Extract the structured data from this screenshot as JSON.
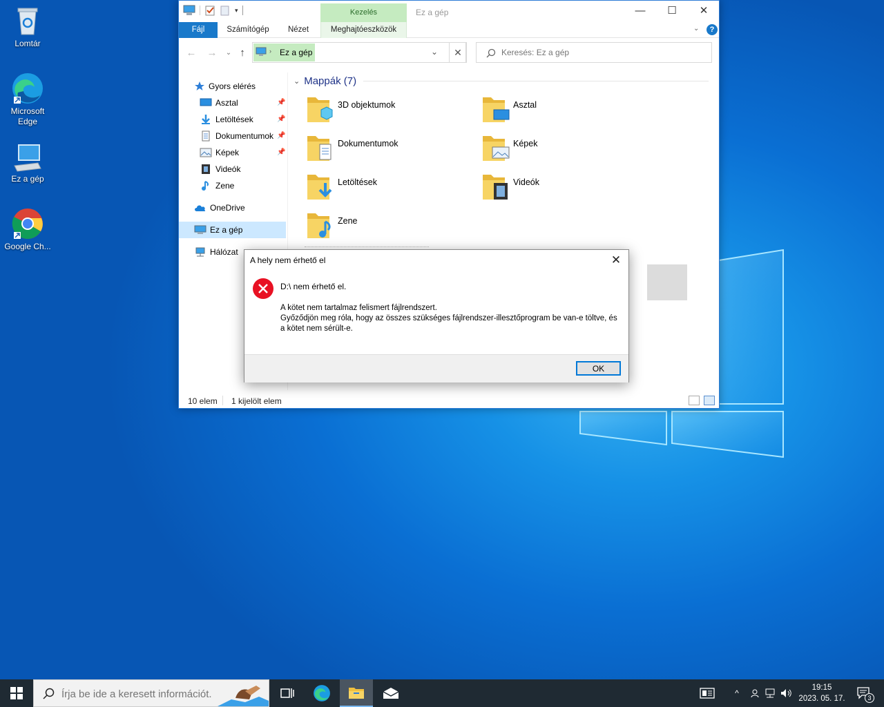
{
  "desktop": {
    "icons": [
      {
        "label": "Lomtár",
        "icon": "recycle-bin-icon"
      },
      {
        "label": "Microsoft Edge",
        "icon": "edge-icon"
      },
      {
        "label": "Ez a gép",
        "icon": "this-pc-icon"
      },
      {
        "label": "Google Ch...",
        "icon": "chrome-icon"
      }
    ]
  },
  "explorer": {
    "title": "Ez a gép",
    "context_tab_group": "Kezelés",
    "ribbon_tabs": [
      "Fájl",
      "Számítógép",
      "Nézet",
      "Meghajtóeszközök"
    ],
    "address": "Ez a gép",
    "search_placeholder": "Keresés: Ez a gép",
    "sidebar": {
      "quick_access": "Gyors elérés",
      "quick_items": [
        {
          "label": "Asztal",
          "pinned": true
        },
        {
          "label": "Letöltések",
          "pinned": true
        },
        {
          "label": "Dokumentumok",
          "pinned": true
        },
        {
          "label": "Képek",
          "pinned": true
        },
        {
          "label": "Videók",
          "pinned": false
        },
        {
          "label": "Zene",
          "pinned": false
        }
      ],
      "onedrive": "OneDrive",
      "this_pc": "Ez a gép",
      "network": "Hálózat"
    },
    "section_title": "Mappák (7)",
    "folders": [
      "3D objektumok",
      "Asztal",
      "Dokumentumok",
      "Képek",
      "Letöltések",
      "Videók",
      "Zene"
    ],
    "status": {
      "items": "10 elem",
      "selected": "1 kijelölt elem"
    }
  },
  "dialog": {
    "title": "A hely nem érhető el",
    "message": "D:\\ nem érhető el.",
    "detail": "A kötet nem tartalmaz felismert fájlrendszert.\nGyőződjön meg róla, hogy az összes szükséges fájlrendszer-illesztőprogram be van-e töltve, és\na kötet nem sérült-e.",
    "ok_label": "OK"
  },
  "taskbar": {
    "search_placeholder": "Írja be ide a keresett információt.",
    "time": "19:15",
    "date": "2023. 05. 17.",
    "notification_count": "3"
  },
  "colors": {
    "accent": "#0078d7",
    "ribbon_file": "#1979ca",
    "context_tab": "#c5ebc0",
    "selection": "#cce8ff",
    "taskbar": "#1f2a33",
    "error": "#e81123"
  }
}
